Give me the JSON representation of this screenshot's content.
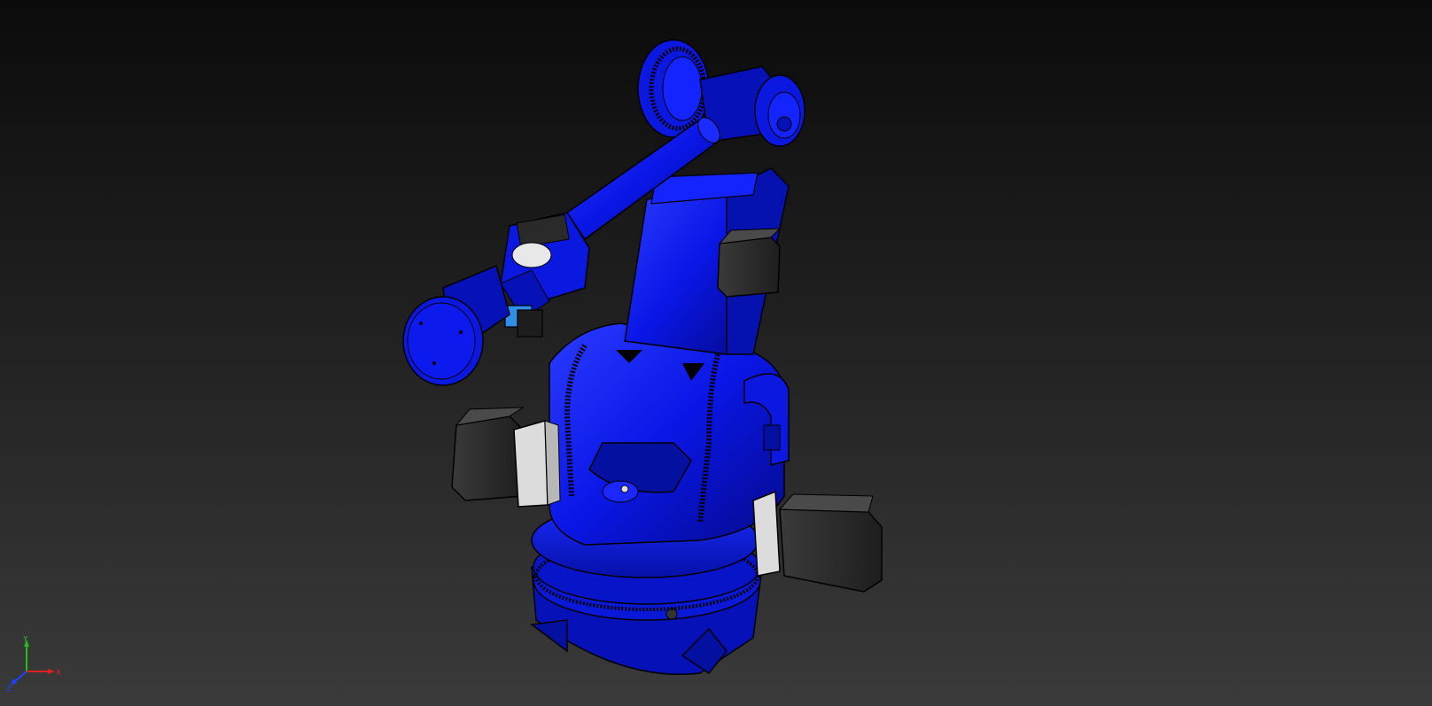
{
  "viewport": {
    "background_top": "#0b0b0b",
    "background_bottom": "#3a3a3a"
  },
  "model": {
    "body_color": "#0a16e6",
    "body_dark": "#0610a8",
    "body_shadow": "#040a6e",
    "body_light": "#2a3cff",
    "motor_color": "#2e2e2e",
    "motor_dark": "#1a1a1a",
    "flange_color": "#d9d9d9",
    "sensor_color": "#2f8fe8"
  },
  "triad": {
    "x_label": "X",
    "y_label": "Y",
    "z_label": "Z",
    "x_color": "#e02020",
    "y_color": "#20c020",
    "z_color": "#2040ff"
  }
}
